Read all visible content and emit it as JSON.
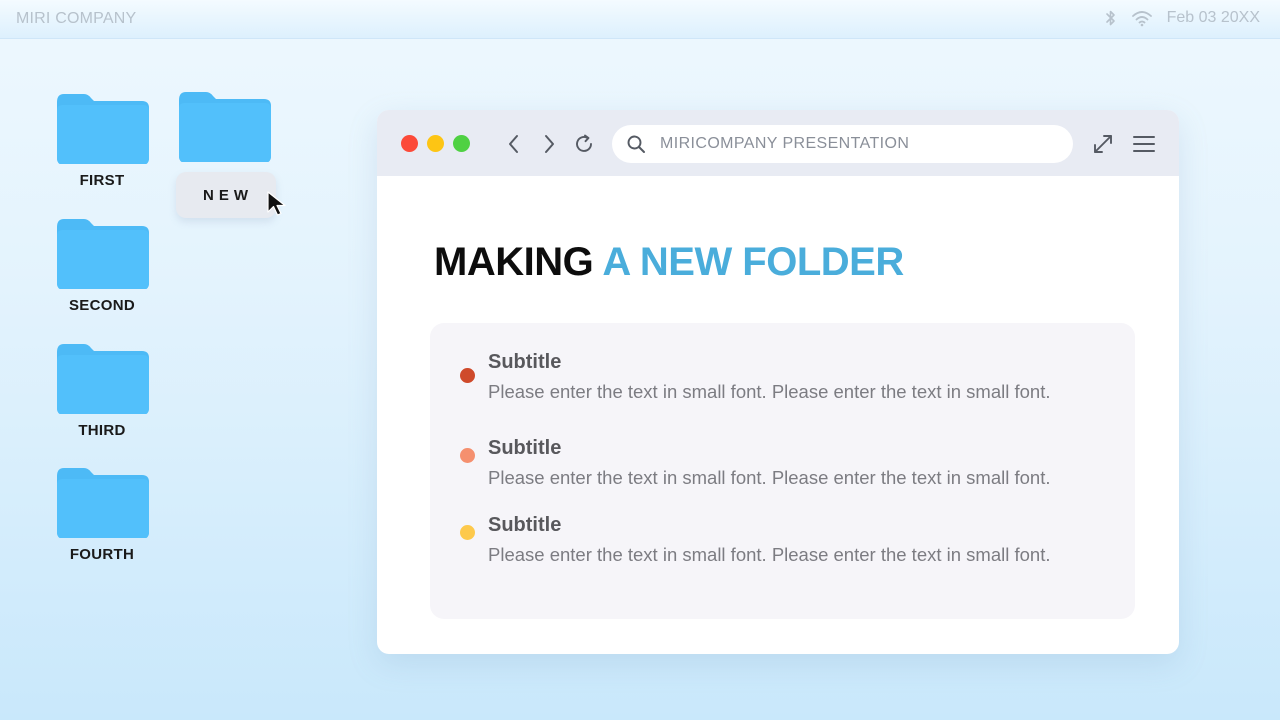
{
  "menubar": {
    "brand": "MIRI COMPANY",
    "date": "Feb 03 20XX",
    "icons": [
      "bluetooth-icon",
      "wifi-icon"
    ]
  },
  "desktop": {
    "folder_color": "#4dbaf6",
    "folders": [
      {
        "label": "FIRST"
      },
      {
        "label": "SECOND"
      },
      {
        "label": "THIRD"
      },
      {
        "label": "FOURTH"
      }
    ],
    "new_folder": {
      "name_value": "NEW"
    }
  },
  "browser": {
    "traffic_lights": [
      "#fc4a39",
      "#fdc514",
      "#4fd143"
    ],
    "address": {
      "value": "MIRICOMPANY PRESENTATION"
    },
    "toolbar_icons": [
      "back-icon",
      "forward-icon",
      "reload-icon",
      "search-icon",
      "expand-icon",
      "menu-icon"
    ]
  },
  "slide": {
    "headline_dark": "MAKING",
    "headline_accent": "A NEW FOLDER",
    "accent_color": "#4aaddb",
    "items": [
      {
        "title": "Subtitle",
        "text": "Please enter the text in small font. Please enter the text in small font.",
        "color": "#cf4a2b"
      },
      {
        "title": "Subtitle",
        "text": "Please enter the text in small font. Please enter the text in small font.",
        "color": "#f5906f"
      },
      {
        "title": "Subtitle",
        "text": "Please enter the text in small font. Please enter the text in small font.",
        "color": "#fdc94c"
      }
    ]
  }
}
